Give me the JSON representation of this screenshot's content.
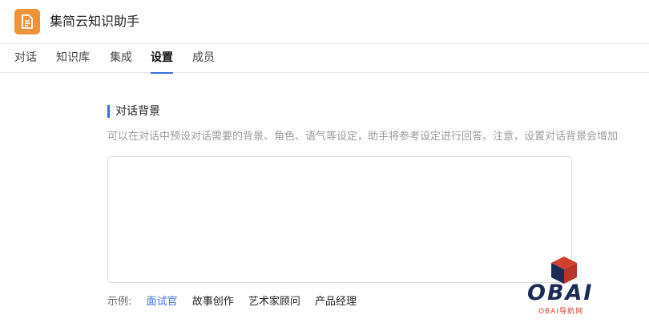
{
  "app": {
    "title": "集简云知识助手",
    "icon": "document-icon",
    "icon_color": "#f0923a"
  },
  "tabs": [
    {
      "label": "对话",
      "active": false
    },
    {
      "label": "知识库",
      "active": false
    },
    {
      "label": "集成",
      "active": false
    },
    {
      "label": "设置",
      "active": true
    },
    {
      "label": "成员",
      "active": false
    }
  ],
  "section": {
    "title": "对话背景",
    "description": "可以在对话中预设对话需要的背景、角色、语气等设定，助手将参考设定进行回答。注意，设置对话背景会增加",
    "textarea_value": ""
  },
  "examples": {
    "label": "示例:",
    "items": [
      "面试官",
      "故事创作",
      "艺术家顾问",
      "产品经理"
    ],
    "active_index": 0
  },
  "watermark": {
    "text": "OBAI",
    "subtext": "OBAI导航网"
  },
  "colors": {
    "accent": "#3b6fe0",
    "watermark_red": "#d2402f",
    "watermark_blue": "#1c2b55"
  }
}
